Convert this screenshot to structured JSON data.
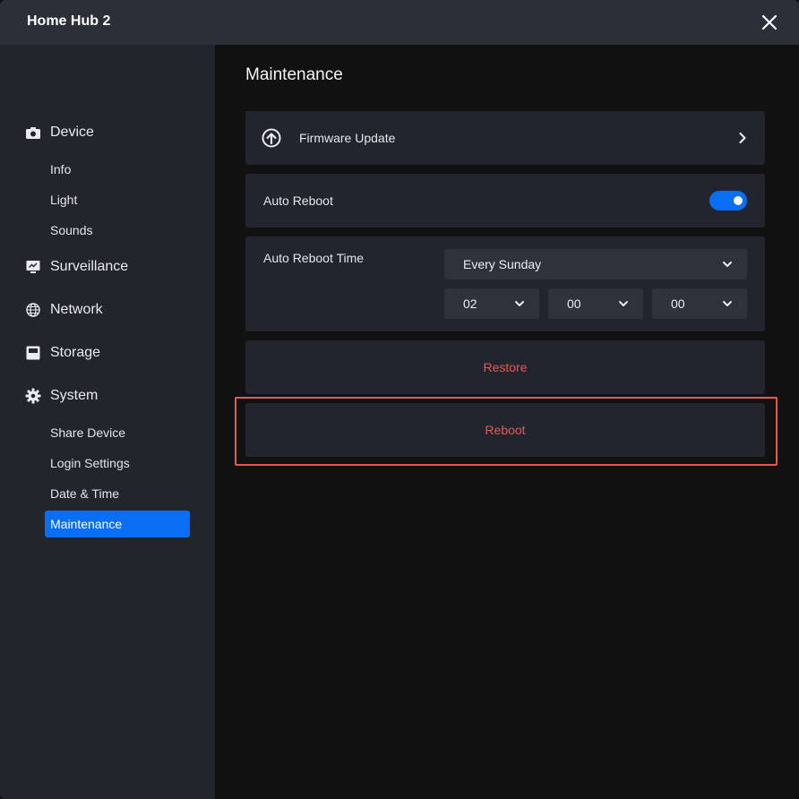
{
  "window": {
    "title": "Home Hub 2"
  },
  "sidebar": {
    "groups": [
      {
        "label": "Device",
        "icon": "camera-icon",
        "items": [
          "Info",
          "Light",
          "Sounds"
        ]
      },
      {
        "label": "Surveillance",
        "icon": "monitor-icon",
        "items": []
      },
      {
        "label": "Network",
        "icon": "globe-icon",
        "items": []
      },
      {
        "label": "Storage",
        "icon": "storage-icon",
        "items": []
      },
      {
        "label": "System",
        "icon": "gear-icon",
        "items": [
          "Share Device",
          "Login Settings",
          "Date & Time",
          "Maintenance"
        ]
      }
    ],
    "active_item": "Maintenance"
  },
  "main": {
    "title": "Maintenance",
    "firmware": {
      "label": "Firmware Update",
      "icon": "upload-icon"
    },
    "auto_reboot": {
      "label": "Auto Reboot",
      "enabled": true
    },
    "reboot_time": {
      "label": "Auto Reboot Time",
      "day": "Every Sunday",
      "hour": "02",
      "minute": "00",
      "second": "00"
    },
    "restore_label": "Restore",
    "reboot_label": "Reboot"
  },
  "colors": {
    "accent": "#0a6ef5",
    "danger_text": "#e05a5a",
    "highlight_border": "#e45a4c"
  }
}
